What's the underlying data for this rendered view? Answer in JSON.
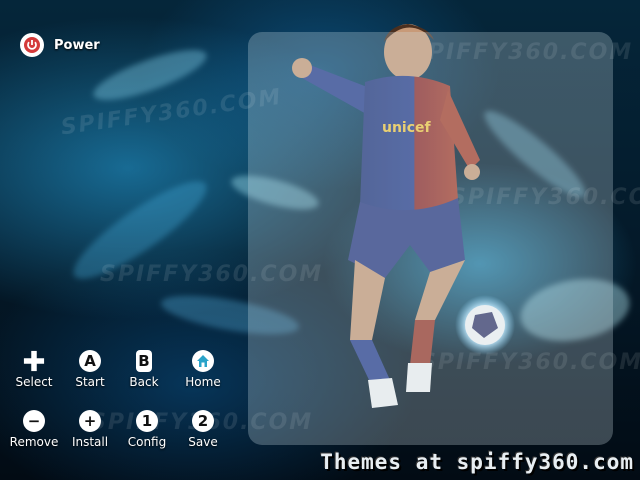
{
  "power": {
    "label": "Power",
    "icon": "power-icon",
    "color": "#d43a3a"
  },
  "controls_row1": [
    {
      "label": "Select",
      "icon": "plus-icon"
    },
    {
      "label": "Start",
      "icon": "a-button-icon",
      "glyph": "A"
    },
    {
      "label": "Back",
      "icon": "b-button-icon",
      "glyph": "B"
    },
    {
      "label": "Home",
      "icon": "home-icon"
    }
  ],
  "controls_row2": [
    {
      "label": "Remove",
      "icon": "minus-icon",
      "glyph": "−"
    },
    {
      "label": "Install",
      "icon": "plus-circle-icon",
      "glyph": "+"
    },
    {
      "label": "Config",
      "icon": "one-button-icon",
      "glyph": "1"
    },
    {
      "label": "Save",
      "icon": "two-button-icon",
      "glyph": "2"
    }
  ],
  "footer": {
    "text": "Themes at spiffy360.com"
  },
  "watermarks": [
    "SPIFFY360.COM",
    "SPIFFY360.COM",
    "SPIFFY360.COM",
    "SPIFFY360.COM",
    "SPIFFY360.COM",
    "SPIFFY360.COM"
  ],
  "colors": {
    "home_accent": "#2aa3c9",
    "panel": "rgba(210,225,235,0.28)"
  }
}
